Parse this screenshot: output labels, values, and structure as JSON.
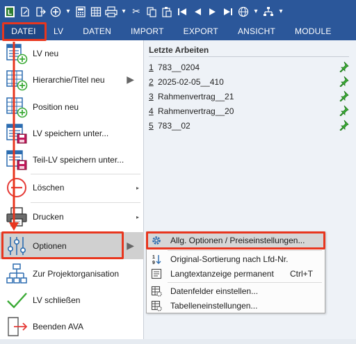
{
  "quick_access": {
    "icons": [
      "app-icon",
      "edit-document-icon",
      "exit-icon",
      "add-circle-icon",
      "dropdown-arrow",
      "calculator-icon",
      "grid-icon",
      "printer-icon",
      "dropdown-arrow",
      "cut-icon",
      "copy-icon",
      "paste-icon",
      "first-icon",
      "previous-icon",
      "next-icon",
      "last-icon",
      "globe-icon",
      "dropdown-arrow",
      "tree-icon",
      "dropdown-arrow"
    ]
  },
  "ribbon": {
    "tabs": [
      "DATEI",
      "LV",
      "DATEN",
      "IMPORT",
      "EXPORT",
      "ANSICHT",
      "MODULE"
    ],
    "active_tab": "DATEI"
  },
  "menu": {
    "items": [
      {
        "label": "LV neu"
      },
      {
        "label": "Hierarchie/Titel neu"
      },
      {
        "label": "Position neu"
      },
      {
        "label": "LV speichern unter..."
      },
      {
        "label": "Teil-LV speichern unter..."
      },
      {
        "label": "Löschen"
      },
      {
        "label": "Drucken"
      },
      {
        "label": "Optionen"
      },
      {
        "label": "Zur Projektorganisation"
      },
      {
        "label": "LV schließen"
      },
      {
        "label": "Beenden AVA"
      }
    ],
    "selected": "Optionen"
  },
  "recent": {
    "title": "Letzte Arbeiten",
    "items": [
      {
        "num": "1",
        "name": "783__0204"
      },
      {
        "num": "2",
        "name": "2025-02-05__410"
      },
      {
        "num": "3",
        "name": "Rahmenvertrag__21"
      },
      {
        "num": "4",
        "name": "Rahmenvertrag__20"
      },
      {
        "num": "5",
        "name": "783__02"
      }
    ]
  },
  "submenu": {
    "items": [
      {
        "label": "Allg. Optionen / Preiseinstellungen...",
        "shortcut": ""
      },
      {
        "label": "Original-Sortierung nach Lfd-Nr.",
        "shortcut": ""
      },
      {
        "label": "Langtextanzeige permanent",
        "shortcut": "Ctrl+T"
      },
      {
        "label": "Datenfelder einstellen...",
        "shortcut": ""
      },
      {
        "label": "Tabelleneinstellungen...",
        "shortcut": ""
      }
    ],
    "selected": "Allg. Optionen / Preiseinstellungen..."
  },
  "colors": {
    "ribbon_blue": "#2b579a",
    "active_tab": "#1e4684",
    "annotation_red": "#e8361e",
    "pin_green": "#3aaa35",
    "icon_blue": "#2b6cb0"
  }
}
